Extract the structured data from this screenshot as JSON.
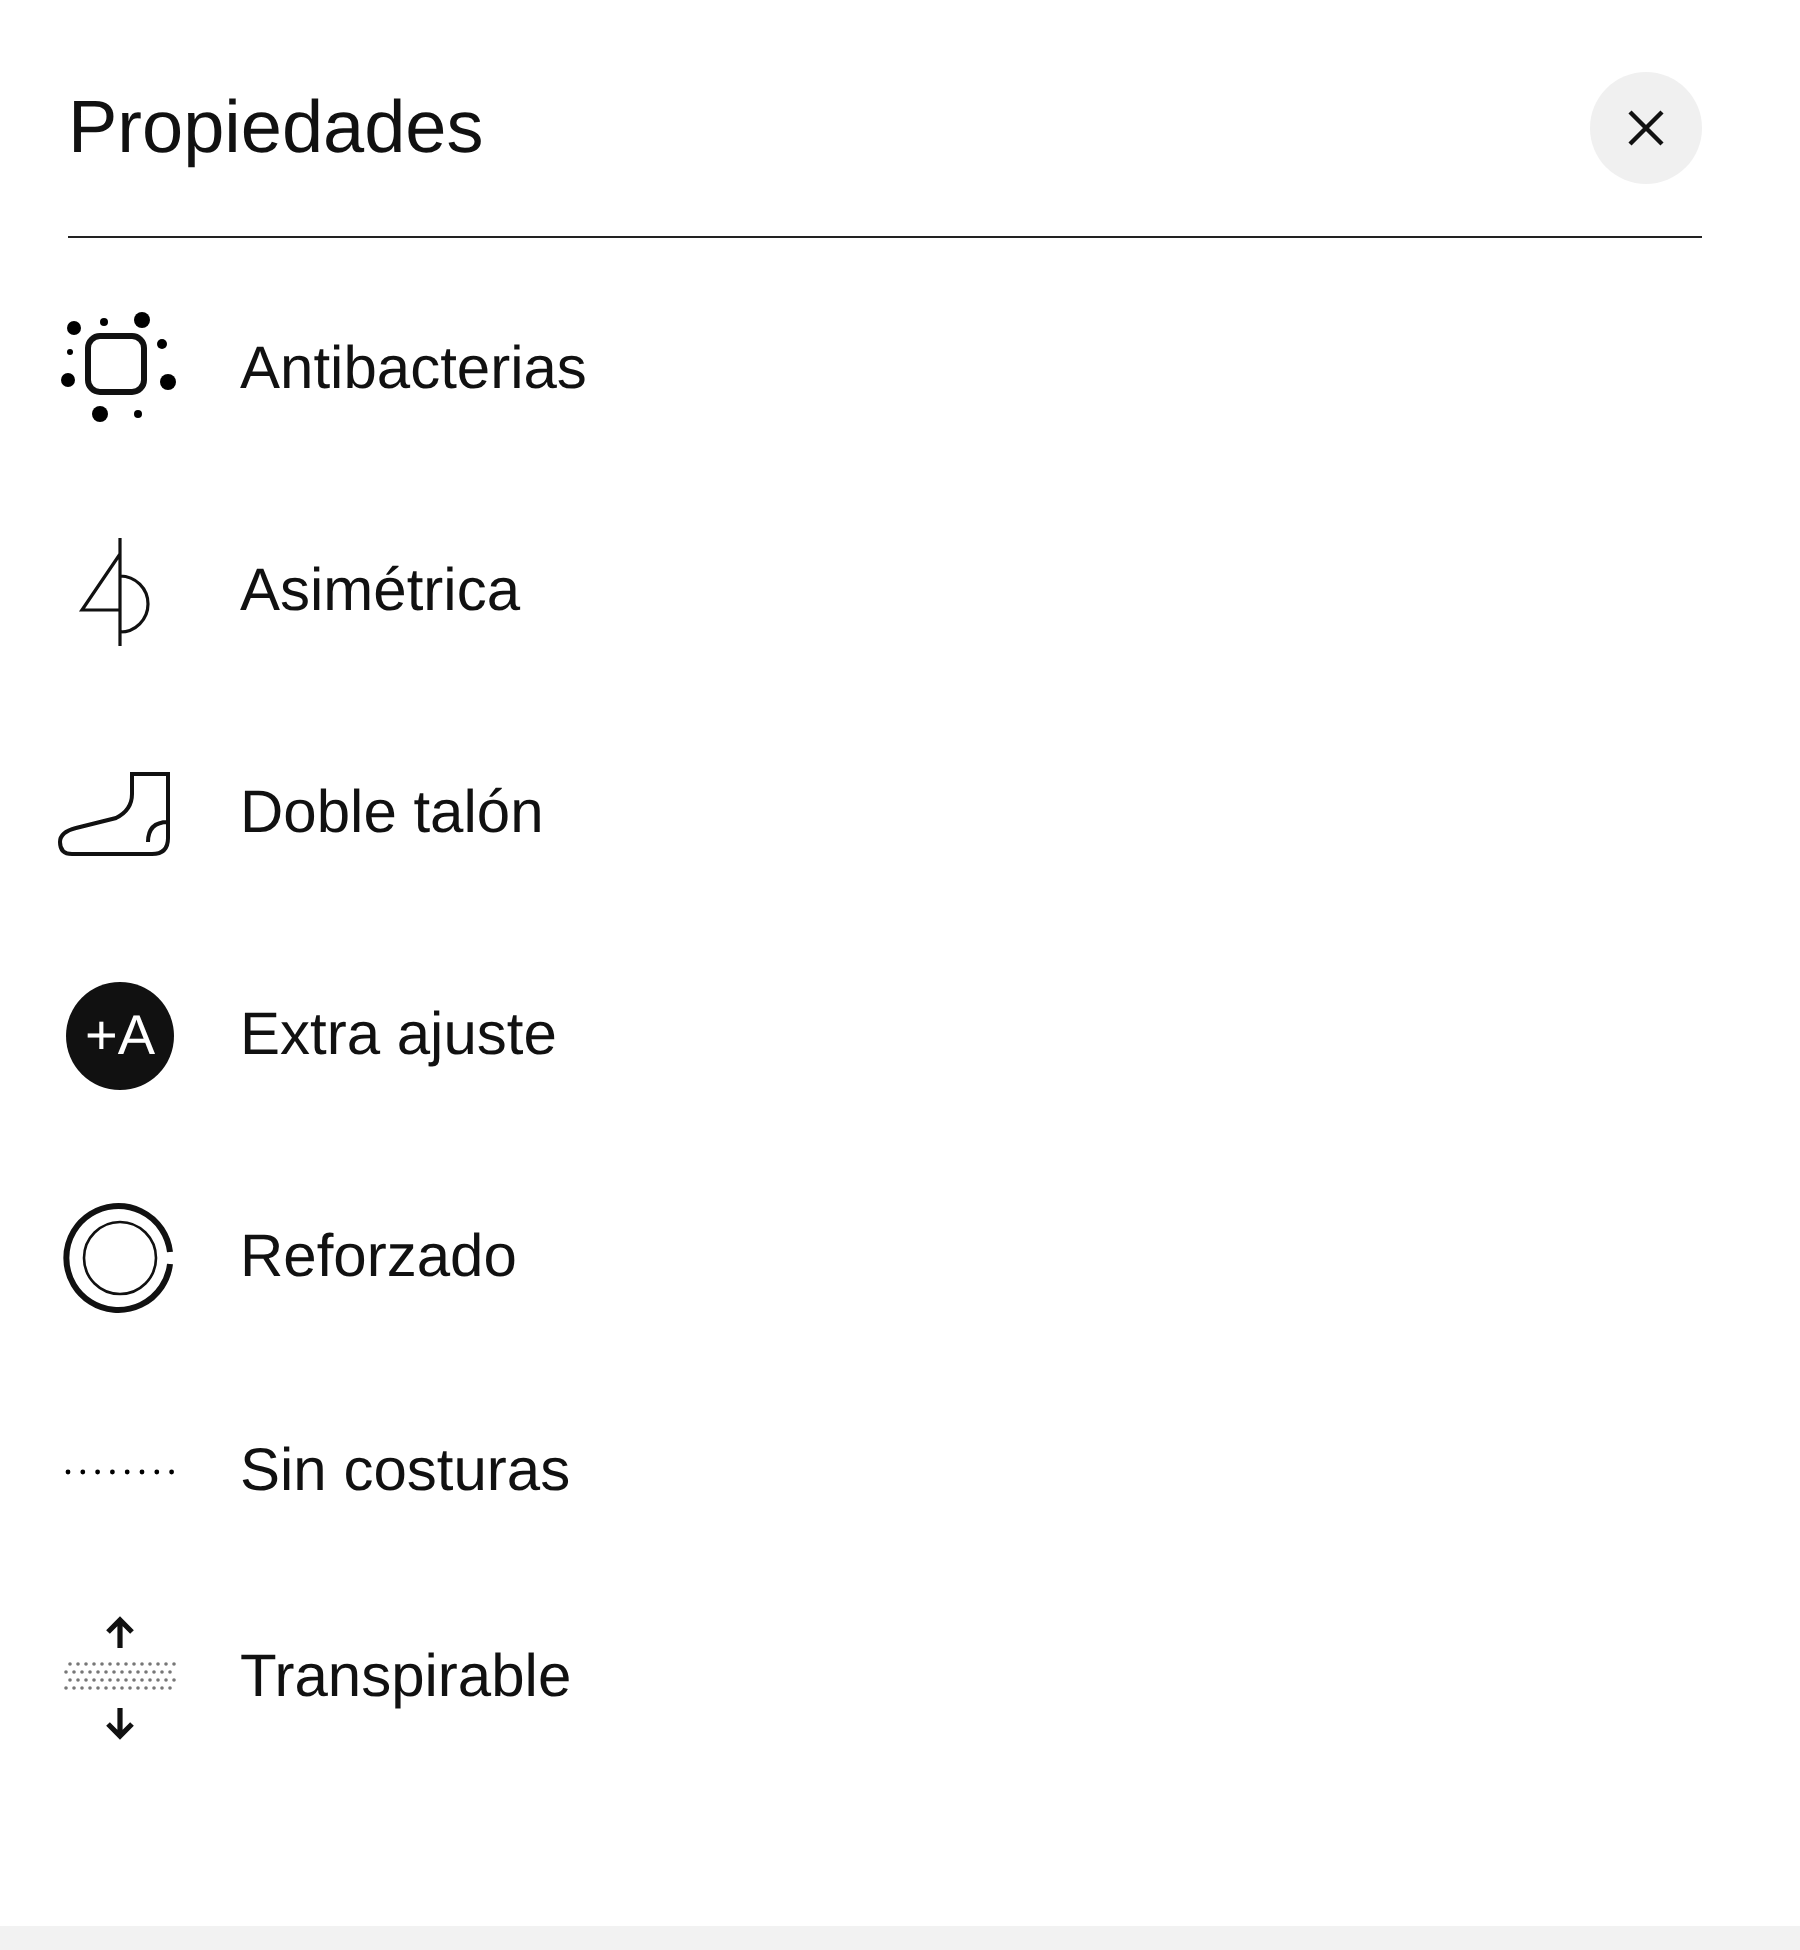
{
  "header": {
    "title": "Propiedades"
  },
  "items": [
    {
      "kind": "dots",
      "label": "Antibacterias"
    },
    {
      "kind": "asymmetric",
      "label": "Asimétrica"
    },
    {
      "kind": "heel",
      "label": "Doble talón"
    },
    {
      "kind": "badge",
      "badge": "+A",
      "label": "Extra ajuste"
    },
    {
      "kind": "rings",
      "label": "Reforzado"
    },
    {
      "kind": "seam",
      "label": "Sin costuras"
    },
    {
      "kind": "breath",
      "label": "Transpirable"
    }
  ]
}
